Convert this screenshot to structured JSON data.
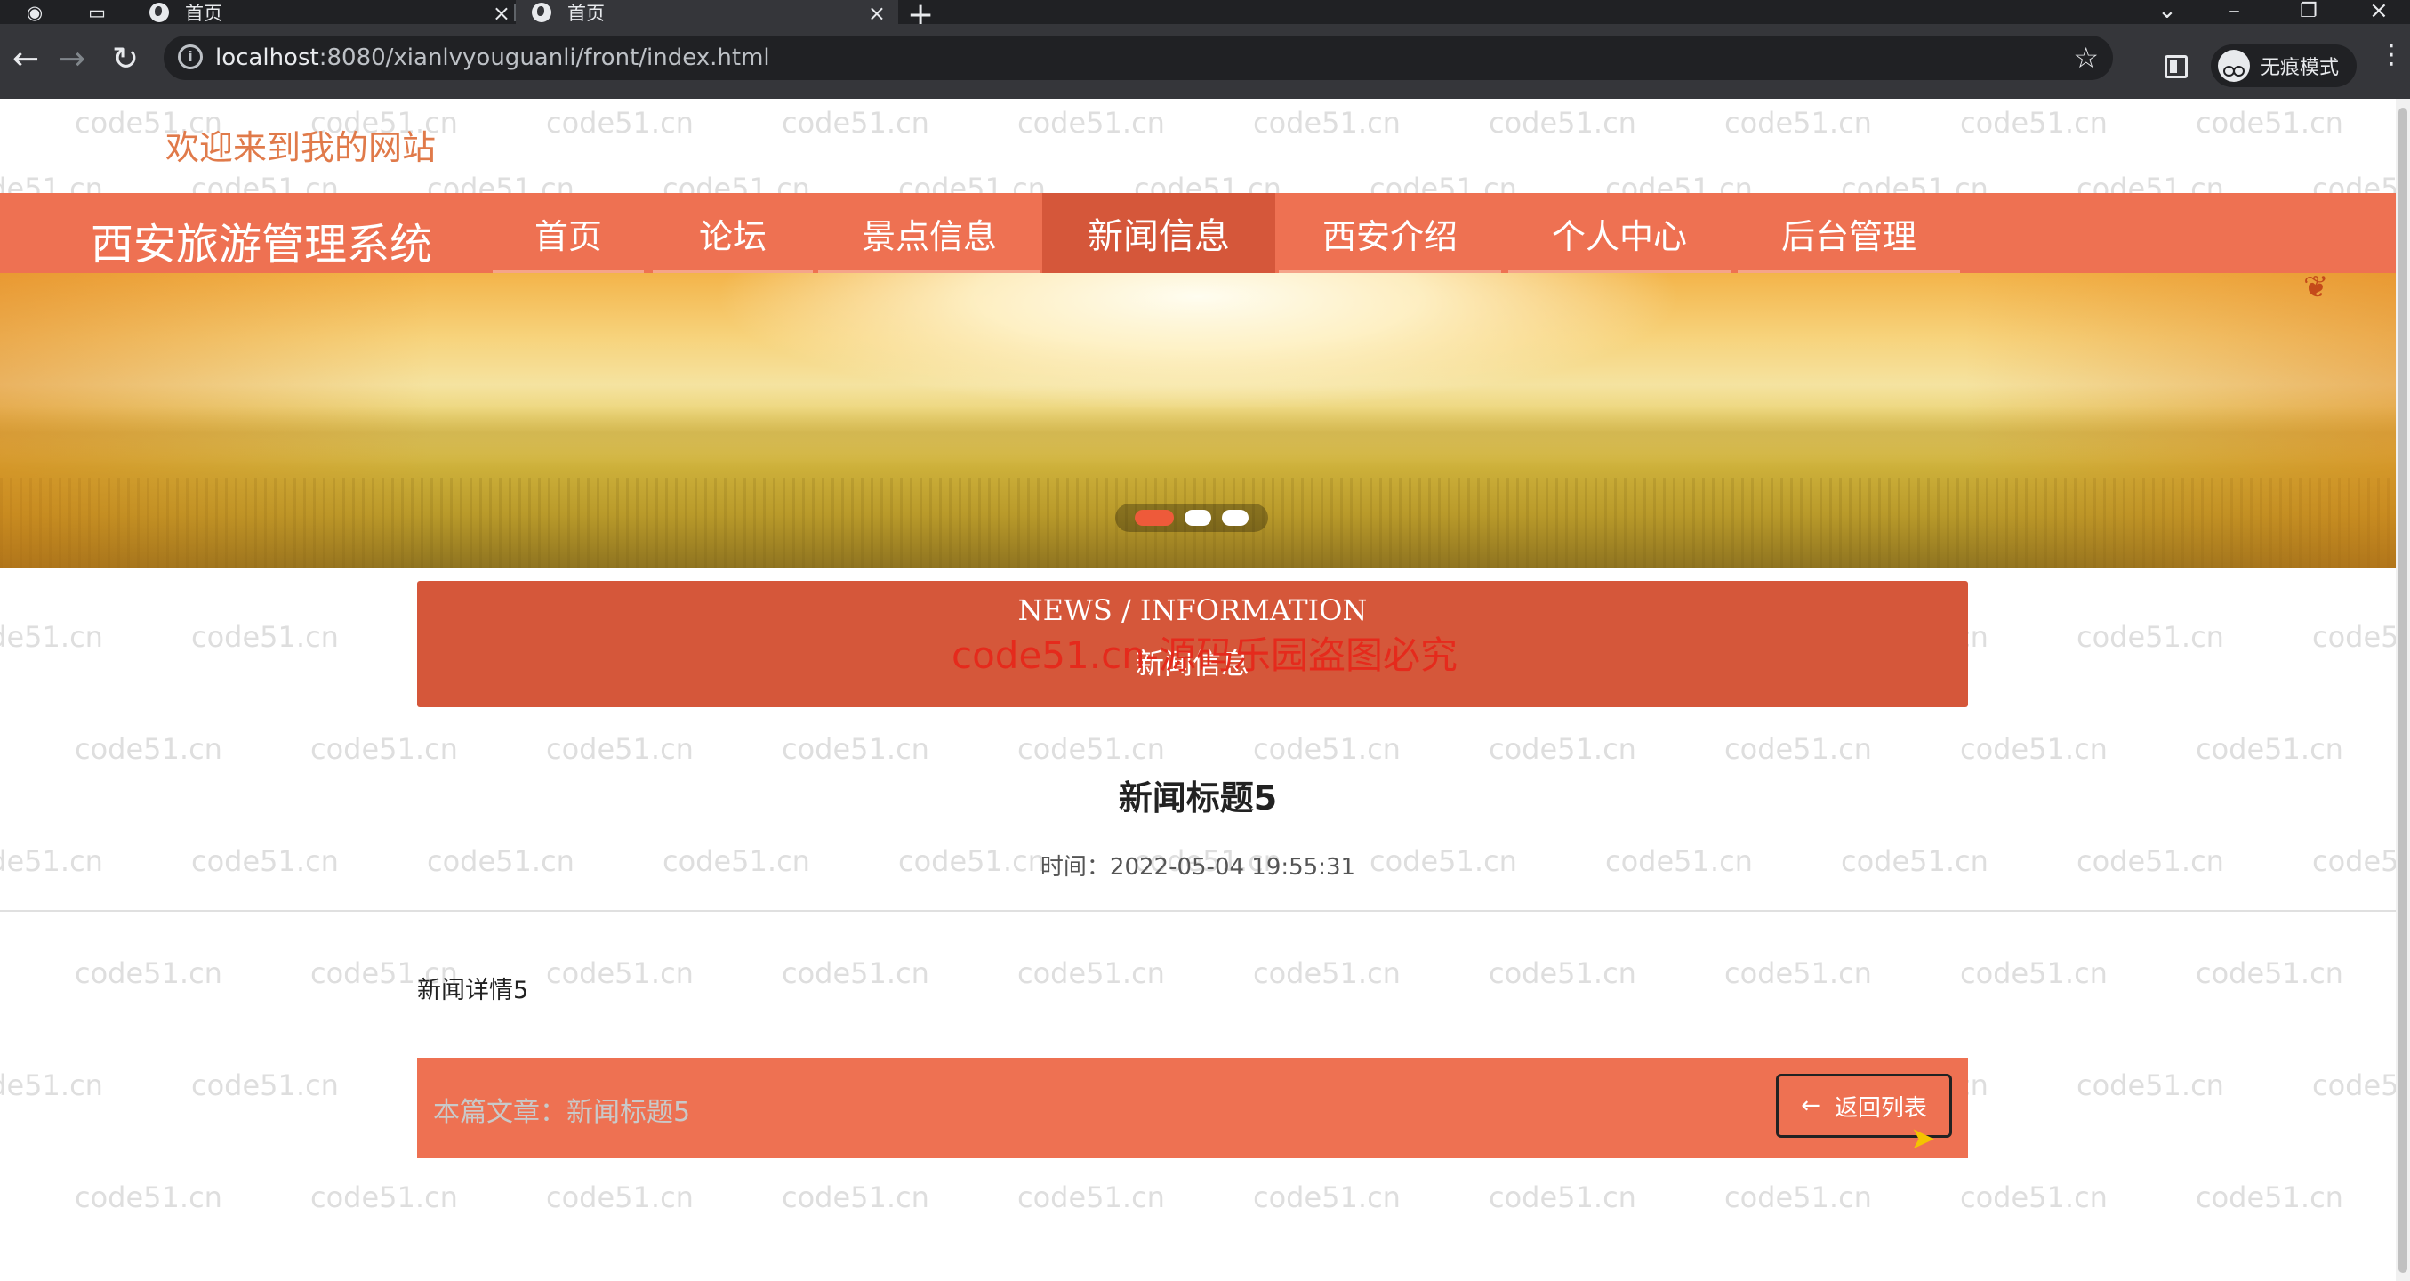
{
  "browser": {
    "tabs": [
      {
        "title": "首页",
        "active": false
      },
      {
        "title": "首页",
        "active": true
      }
    ],
    "url_host": "localhost",
    "url_rest": ":8080/xianlvyouguanli/front/index.html",
    "incognito_label": "无痕模式"
  },
  "page": {
    "welcome": "欢迎来到我的网站",
    "brand": "西安旅游管理系统",
    "nav": [
      {
        "label": "首页",
        "active": false
      },
      {
        "label": "论坛",
        "active": false
      },
      {
        "label": "景点信息",
        "active": false
      },
      {
        "label": "新闻信息",
        "active": true
      },
      {
        "label": "西安介绍",
        "active": false
      },
      {
        "label": "个人中心",
        "active": false
      },
      {
        "label": "后台管理",
        "active": false
      }
    ],
    "carousel": {
      "slides": 3,
      "active_index": 0
    },
    "section": {
      "en": "NEWS / INFORMATION",
      "cn": "新闻信息"
    },
    "overlay_notice": "code51.cn-源码乐园盗图必究",
    "article": {
      "title": "新闻标题5",
      "time": "时间：2022-05-04 19:55:31",
      "body": "新闻详情5"
    },
    "footer": {
      "current_article": "本篇文章：新闻标题5",
      "back_label": "返回列表"
    },
    "watermark": "code51.cn"
  },
  "colors": {
    "nav_bg": "#ee7152",
    "nav_active": "#d5573a",
    "welcome_text": "#e07a4a",
    "overlay_red": "#e52a1c"
  }
}
